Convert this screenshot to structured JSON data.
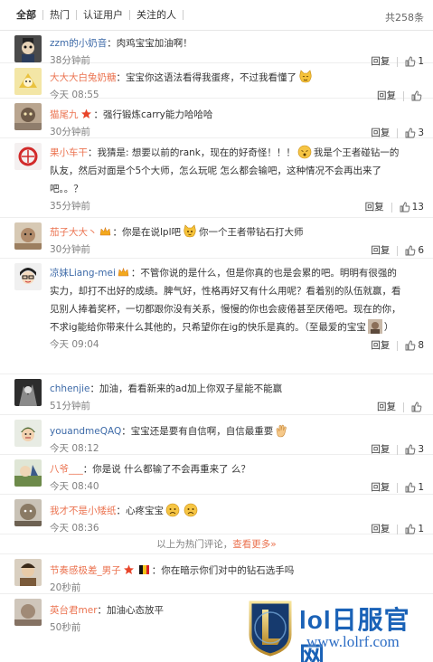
{
  "tabs": {
    "items": [
      "全部",
      "热门",
      "认证用户",
      "关注的人"
    ],
    "total": "共258条"
  },
  "reply_label": "回复",
  "divider": {
    "text": "以上为热门评论，",
    "more": "查看更多»"
  },
  "comments": [
    {
      "user": "zzm的小奶音",
      "text": "肉鸡宝宝加油啊！",
      "time": "38分钟前",
      "likes": "1"
    },
    {
      "user": "大大大白兔奶糖",
      "text": "宝宝你这语法看得我蛋疼，不过我看懂了",
      "time": "今天 08:55",
      "likes": ""
    },
    {
      "user": "猫尾九",
      "text": "强行锻炼carry能力哈哈哈",
      "time": "30分钟前",
      "likes": "3"
    },
    {
      "user": "果小车干",
      "text": "我猜是: 想要以前的rank，现在的好奇怪！！！",
      "text2": "我是个王者碰钻一的队友，然后对面是个5个大师，怎么玩呢 怎么都会输吧，这种情况不会再出来了吧。。？",
      "time": "35分钟前",
      "likes": "13"
    },
    {
      "user": "茄子大大丶",
      "text": "你是在说lpl吧",
      "text2": "你一个王者带钻石打大师",
      "time": "30分钟前",
      "likes": "6"
    },
    {
      "user": "凉妹Liang-mei",
      "text": "不管你说的是什么，但是你真的也是会累的吧。明明有很强的实力，却打不出好的成绩。脾气好，性格再好又有什么用呢？看着别的队伍就赢，看见别人捧着奖杯，一切都跟你没有关系，慢慢的你也会疲倦甚至厌倦吧。现在的你，不求ig能给你带来什么其他的，只希望你在ig的快乐是真的。（至最爱的宝宝",
      "text2": "）",
      "time": "今天 09:04",
      "likes": "8"
    },
    {
      "user": "chhenjie",
      "text": "加油，看看新来的ad加上你双子星能不能赢",
      "time": "51分钟前",
      "likes": ""
    },
    {
      "user": "youandmeQAQ",
      "text": "宝宝还是要有自信啊，自信最重要",
      "time": "今天 08:12",
      "likes": "3"
    },
    {
      "user": "八爷___",
      "text": "你是说  什么都输了不会再重来了  么？",
      "time": "今天 08:40",
      "likes": "1"
    },
    {
      "user": "我才不是小矮纸",
      "text": "心疼宝宝",
      "time": "今天 08:36",
      "likes": "1"
    },
    {
      "user": "节奏感极差_男子",
      "text": "你在暗示你们对中的钻石选手吗",
      "time": "20秒前",
      "likes": ""
    },
    {
      "user": "英台君mer",
      "text": "加油心态放平",
      "time": "50秒前",
      "likes": ""
    }
  ],
  "watermark": {
    "title": "lol日服官网",
    "url": "www.lolrf.com"
  },
  "colors": {
    "username": "#eb7350",
    "link_blue": "#3d6aa8",
    "meta_gray": "#808080",
    "watermark_blue": "#1a62b7"
  }
}
